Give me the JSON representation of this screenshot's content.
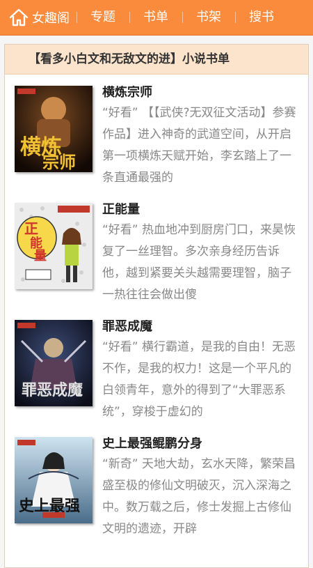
{
  "header": {
    "site_name": "女趣阁",
    "nav": [
      "专题",
      "书单",
      "书架",
      "搜书"
    ]
  },
  "panel": {
    "title": "【看多小白文和无敌文的进】小说书单"
  },
  "books": [
    {
      "title": "横炼宗师",
      "tag": "“好看”",
      "desc": "【【武侠?无双征文活动】参赛作品】进入神奇的武道空间，从开启第一项横炼天赋开始，李玄踏上了一条直通最强的"
    },
    {
      "title": "正能量",
      "tag": "“好看”",
      "desc": "热血地冲到厨房门口，来昊恢复了一丝理智。多次亲身经历告诉他，越到紧要关头越需要理智，脑子一热往往会做出傻"
    },
    {
      "title": "罪恶成魔",
      "tag": "“好看”",
      "desc": "横行霸道，是我的自由！无恶不作，是我的权力！这是一个平凡的白领青年，意外的得到了“大罪恶系统”，穿梭于虚幻的"
    },
    {
      "title": "史上最强鲲鹏分身",
      "tag": "“新奇”",
      "desc": "天地大劫，玄水天降，繁荣昌盛至极的修仙文明破灭，沉入深海之中。数万载之后，修士发掘上古修仙文明的遗迹，开辟"
    }
  ],
  "colors": {
    "header_bg": "#fa8a3c",
    "panel_title_bg": "#fbe3cc"
  },
  "icons": {
    "home": "home-icon"
  }
}
